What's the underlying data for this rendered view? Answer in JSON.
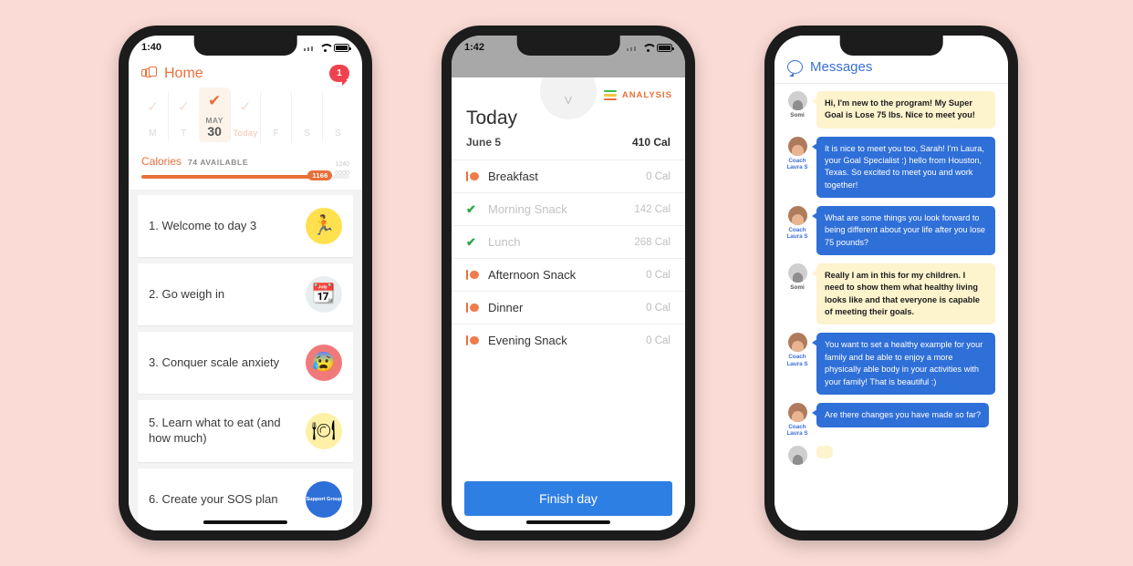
{
  "background_color": "#fbdbd5",
  "phone1": {
    "name": "home-screen",
    "statusbar": {
      "time": "1:40"
    },
    "header": {
      "title": "Home",
      "icon": "cards-icon",
      "badge_count": "1",
      "title_color": "#e8703a",
      "badge_color": "#f0414f"
    },
    "daystrip": [
      {
        "label": "M",
        "state": "past",
        "tick": true
      },
      {
        "label": "T",
        "state": "past",
        "tick": true
      },
      {
        "label": "",
        "month": "MAY",
        "day": "30",
        "state": "selected",
        "tick": true
      },
      {
        "label": "Today",
        "state": "today",
        "tick": true
      },
      {
        "label": "F",
        "state": "future",
        "tick": false
      },
      {
        "label": "S",
        "state": "future",
        "tick": false
      },
      {
        "label": "S",
        "state": "future",
        "tick": false
      }
    ],
    "calories": {
      "label": "Calories",
      "available": "74 AVAILABLE",
      "consumed": "1166",
      "goal_line1": "1240",
      "goal_line2": "0000",
      "progress_percent": 86,
      "accent": "#e8703a"
    },
    "cards": [
      {
        "text": "1. Welcome to day 3",
        "thumb": "person-jumping",
        "glyph": "🏃",
        "thumb_class": "t-yellow"
      },
      {
        "text": "2. Go weigh in",
        "thumb": "calendar",
        "glyph": "📆",
        "thumb_class": "t-cal"
      },
      {
        "text": "3. Conquer scale anxiety",
        "thumb": "worried-person",
        "glyph": "😰",
        "thumb_class": "t-pink"
      },
      {
        "text": "5. Learn what to eat (and how much)",
        "thumb": "plate-of-food",
        "glyph": "🍽",
        "thumb_class": "t-plate"
      },
      {
        "text": "6. Create your SOS plan",
        "thumb": "support-group",
        "glyph": "",
        "thumb_class": "t-blue",
        "sub": "Support Group"
      }
    ]
  },
  "phone2": {
    "name": "today-food-log",
    "statusbar": {
      "time": "1:42"
    },
    "analysis": {
      "label": "ANALYSIS",
      "icon": "bars-icon"
    },
    "title": "Today",
    "date": "June 5",
    "total_calories": "410 Cal",
    "meals": [
      {
        "name": "Breakfast",
        "cal": "0 Cal",
        "state": "pending",
        "icon": "fork-plate-icon"
      },
      {
        "name": "Morning Snack",
        "cal": "142 Cal",
        "state": "done",
        "icon": "check-icon"
      },
      {
        "name": "Lunch",
        "cal": "268 Cal",
        "state": "done",
        "icon": "check-icon"
      },
      {
        "name": "Afternoon Snack",
        "cal": "0 Cal",
        "state": "pending",
        "icon": "fork-plate-icon"
      },
      {
        "name": "Dinner",
        "cal": "0 Cal",
        "state": "pending",
        "icon": "fork-plate-icon"
      },
      {
        "name": "Evening Snack",
        "cal": "0 Cal",
        "state": "pending",
        "icon": "fork-plate-icon"
      }
    ],
    "finish_button": "Finish day",
    "finish_button_color": "#2e7fe4"
  },
  "phone3": {
    "name": "messages-thread",
    "header": {
      "title": "Messages",
      "icon": "chat-bubble-icon",
      "color": "#3a6fd8"
    },
    "messages": [
      {
        "sender": "Somi",
        "side": "incoming",
        "style": "yellow",
        "text": "Hi, I'm new to the program! My Super Goal is Lose 75 lbs. Nice to meet you!"
      },
      {
        "sender": "Coach Laura S",
        "side": "coach",
        "style": "blue",
        "text": "It is nice to meet you too, Sarah! I'm Laura, your Goal Specialist :) hello from Houston, Texas. So excited to meet you and work together!"
      },
      {
        "sender": "Coach Laura S",
        "side": "coach",
        "style": "blue",
        "text": "What are some things you look forward to being different about your life after you lose 75 pounds?"
      },
      {
        "sender": "Somi",
        "side": "incoming",
        "style": "yellow",
        "text": "Really I am in this for my children. I need to show them what healthy living looks like and that everyone is capable of meeting their goals."
      },
      {
        "sender": "Coach Laura S",
        "side": "coach",
        "style": "blue",
        "text": "You want to set a healthy example for your family and be able to enjoy a more physically able body in your activities with your family! That is beautiful :)"
      },
      {
        "sender": "Coach Laura S",
        "side": "coach",
        "style": "blue",
        "text": "Are there changes you have made so far?"
      },
      {
        "sender": "Somi",
        "side": "incoming",
        "style": "yellow",
        "text": ""
      }
    ]
  }
}
